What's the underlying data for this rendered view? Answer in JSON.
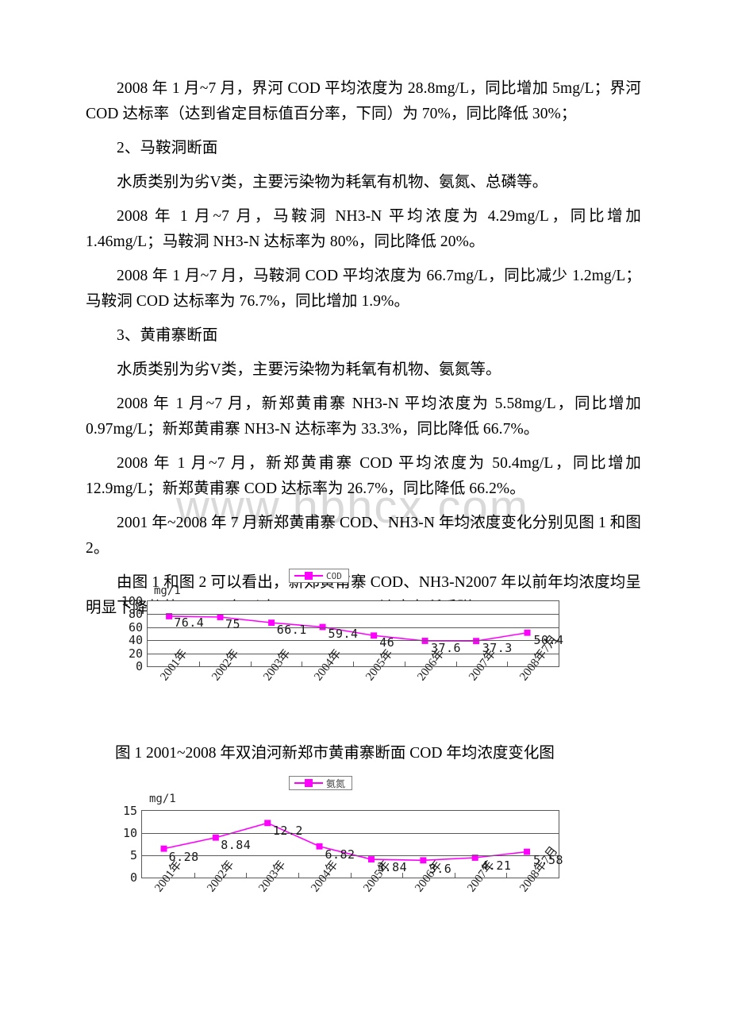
{
  "document": {
    "watermark": "www.hbhcx.com",
    "paragraphs": [
      "2008 年 1 月~7 月，界河 COD 平均浓度为 28.8mg/L，同比增加 5mg/L；界河 COD 达标率（达到省定目标值百分率，下同）为 70%，同比降低 30%；",
      "2、马鞍洞断面",
      "水质类别为劣V类，主要污染物为耗氧有机物、氨氮、总磷等。",
      "2008 年 1 月~7 月，马鞍洞 NH3-N 平均浓度为 4.29mg/L，同比增加 1.46mg/L；马鞍洞 NH3-N 达标率为 80%，同比降低 20%。",
      "2008 年 1 月~7 月，马鞍洞 COD 平均浓度为 66.7mg/L，同比减少 1.2mg/L；马鞍洞 COD 达标率为 76.7%，同比增加 1.9%。",
      "3、黄甫寨断面",
      "水质类别为劣V类，主要污染物为耗氧有机物、氨氮等。",
      "2008 年 1 月~7 月，新郑黄甫寨 NH3-N 平均浓度为 5.58mg/L，同比增加 0.97mg/L；新郑黄甫寨 NH3-N 达标率为 33.3%，同比降低 66.7%。",
      "2008 年 1 月~7 月，新郑黄甫寨 COD 平均浓度为 50.4mg/L，同比增加 12.9mg/L；新郑黄甫寨 COD 达标率为 26.7%，同比降低 66.2%。",
      "2001 年~2008 年 7 月新郑黄甫寨 COD、NH3-N 年均浓度变化分别见图 1 和图 2。",
      "由图 1 和图 2 可以看出，新郑黄甫寨 COD、NH3-N2007 年以前年均浓度均呈明显下降趋势；2008 年以来 COD、NH3-N 浓度有所反弹。"
    ],
    "captions": {
      "figure1": "图 1 2001~2008 年双洎河新郑市黄甫寨断面 COD 年均浓度变化图"
    }
  },
  "chart_data": [
    {
      "type": "line",
      "id": "figure1",
      "title": "",
      "series_name": "COD",
      "legend": [
        "COD"
      ],
      "legend_position": "top-center",
      "ylabel": "mg/1",
      "xlabel": "",
      "categories": [
        "2001年",
        "2002年",
        "2003年",
        "2004年",
        "2005年",
        "2006年",
        "2007年",
        "2008年7月"
      ],
      "values": [
        76.4,
        75,
        66.1,
        59.4,
        46,
        37.6,
        37.3,
        50.4
      ],
      "value_labels": [
        "76.4",
        "75",
        "66.1",
        "59.4",
        "46",
        "37.6",
        "37.3",
        "50.4"
      ],
      "ylim": [
        0,
        100
      ],
      "yticks": [
        0,
        20,
        40,
        60,
        80,
        100
      ],
      "ytick_labels": [
        "0",
        "20",
        "40",
        "60",
        "80",
        "100"
      ],
      "grid": true,
      "line_color": "#ff00ff",
      "marker_color": "#ff00ff",
      "marker": "square"
    },
    {
      "type": "line",
      "id": "figure2",
      "title": "",
      "series_name": "氨氮",
      "legend": [
        "氨氮"
      ],
      "legend_position": "top-center",
      "ylabel": "mg/1",
      "xlabel": "",
      "categories": [
        "2001年",
        "2002年",
        "2003年",
        "2004年",
        "2005年",
        "2006年",
        "2007年",
        "2008年7月"
      ],
      "values": [
        6.28,
        8.84,
        12.2,
        6.82,
        3.84,
        3.6,
        4.21,
        5.58
      ],
      "value_labels": [
        "6.28",
        "8.84",
        "12.2",
        "6.82",
        "3.84",
        "3.6",
        "4.21",
        "5.58"
      ],
      "ylim": [
        0,
        15
      ],
      "yticks": [
        0,
        5,
        10,
        15
      ],
      "ytick_labels": [
        "0",
        "5",
        "10",
        "15"
      ],
      "grid": true,
      "line_color": "#ff00ff",
      "marker_color": "#ff00ff",
      "marker": "square"
    }
  ]
}
